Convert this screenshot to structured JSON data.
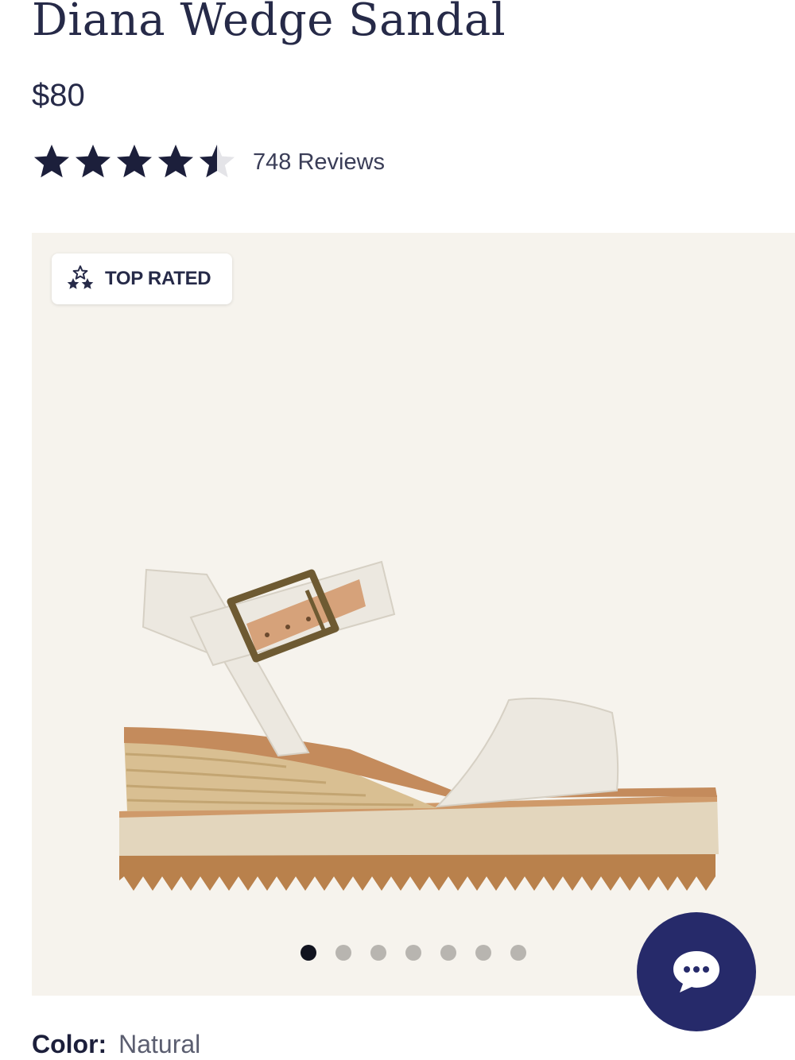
{
  "product": {
    "title": "Diana Wedge Sandal",
    "price": "$80",
    "rating": 4.5,
    "rating_max": 5,
    "reviews_label": "748 Reviews"
  },
  "gallery": {
    "badge_label": "TOP RATED",
    "badge_icon": "three-stars-icon",
    "image_count": 7,
    "active_index": 0
  },
  "color": {
    "label": "Color:",
    "value": "Natural"
  },
  "chat": {
    "icon": "chat-bubble-icon",
    "color": "#262a6a"
  },
  "colors": {
    "text": "#262a48",
    "gallery_background": "#f6f3ed",
    "star": "#1c1f3b"
  }
}
